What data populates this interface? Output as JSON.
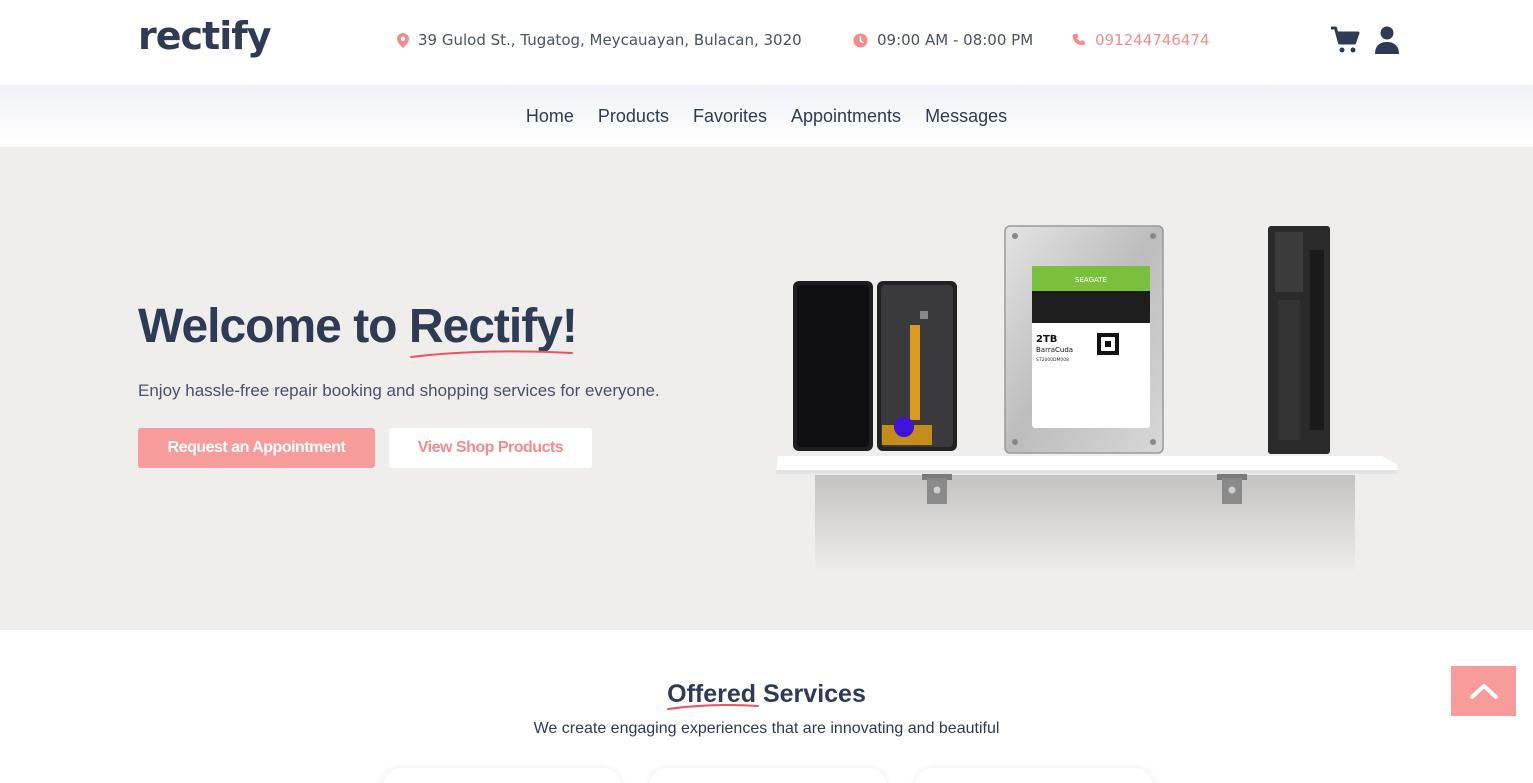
{
  "header": {
    "logo": "rectify",
    "address": "39 Gulod St., Tugatog, Meycauayan, Bulacan, 3020",
    "hours": "09:00 AM - 08:00 PM",
    "phone": "091244746474",
    "icons": [
      "location-pin-icon",
      "clock-icon",
      "phone-icon",
      "cart-icon",
      "user-icon"
    ]
  },
  "nav": {
    "items": [
      "Home",
      "Products",
      "Favorites",
      "Appointments",
      "Messages"
    ]
  },
  "hero": {
    "title_prefix": "Welcome to ",
    "title_brand": "Rectify!",
    "subtitle": "Enjoy hassle-free repair booking and shopping services for everyone.",
    "primary_button": "Request an Appointment",
    "secondary_button": "View Shop Products",
    "illustration": {
      "hdd_brand": "SEAGATE",
      "hdd_capacity": "2TB",
      "hdd_model": "BarraCuda",
      "hdd_part": "ST2000DM008"
    }
  },
  "services": {
    "title_highlight": "Offered",
    "title_rest": " Services",
    "subtitle": "We create engaging experiences that are innovating and beautiful"
  },
  "colors": {
    "accent": "#f89b9b",
    "accent_text": "#f28b8b",
    "text_dark": "#2f3a55",
    "hero_bg": "#efeeec",
    "underline": "#e8545f"
  }
}
